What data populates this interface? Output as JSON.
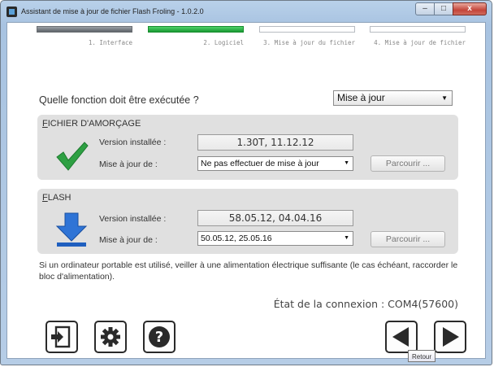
{
  "window": {
    "title": "Assistant de mise à jour de fichier Flash Froling - 1.0.2.0",
    "minimize": "–",
    "maximize": "□",
    "close": "x"
  },
  "steps": [
    {
      "label": "1. Interface",
      "state": "done"
    },
    {
      "label": "2. Logiciel",
      "state": "active"
    },
    {
      "label": "3. Mise à jour du fichier",
      "state": "pending"
    },
    {
      "label": "4. Mise à jour de fichier",
      "state": "pending"
    }
  ],
  "question": "Quelle fonction doit être exécutée ?",
  "function_select": {
    "value": "Mise à jour"
  },
  "boot_group": {
    "title_first": "F",
    "title_rest": "ICHIER D'AMORÇAGE",
    "installed_label": "Version installée :",
    "installed_value": "1.30T, 11.12.12",
    "update_label": "Mise à jour de :",
    "update_value": "Ne pas effectuer de mise à jour",
    "browse": "Parcourir ..."
  },
  "flash_group": {
    "title_first": "F",
    "title_rest": "LASH",
    "installed_label": "Version installée :",
    "installed_value": "58.05.12, 04.04.16",
    "update_label": "Mise à jour de :",
    "update_value": "50.05.12, 25.05.16",
    "browse": "Parcourir ..."
  },
  "info_text": "Si un ordinateur portable est utilisé, veiller à une alimentation électrique suffisante (le cas échéant, raccorder le bloc d'alimentation).",
  "connection": "État de la connexion : COM4(57600)",
  "buttons": {
    "exit_icon": "exit-icon",
    "settings_icon": "gear-icon",
    "help_icon": "help-icon",
    "back_icon": "arrow-left-icon",
    "next_icon": "arrow-right-icon"
  },
  "tooltip": "Retour",
  "colors": {
    "active_step": "#1a9a33",
    "check": "#2ea043",
    "flash_arrow": "#1f5fbf"
  }
}
